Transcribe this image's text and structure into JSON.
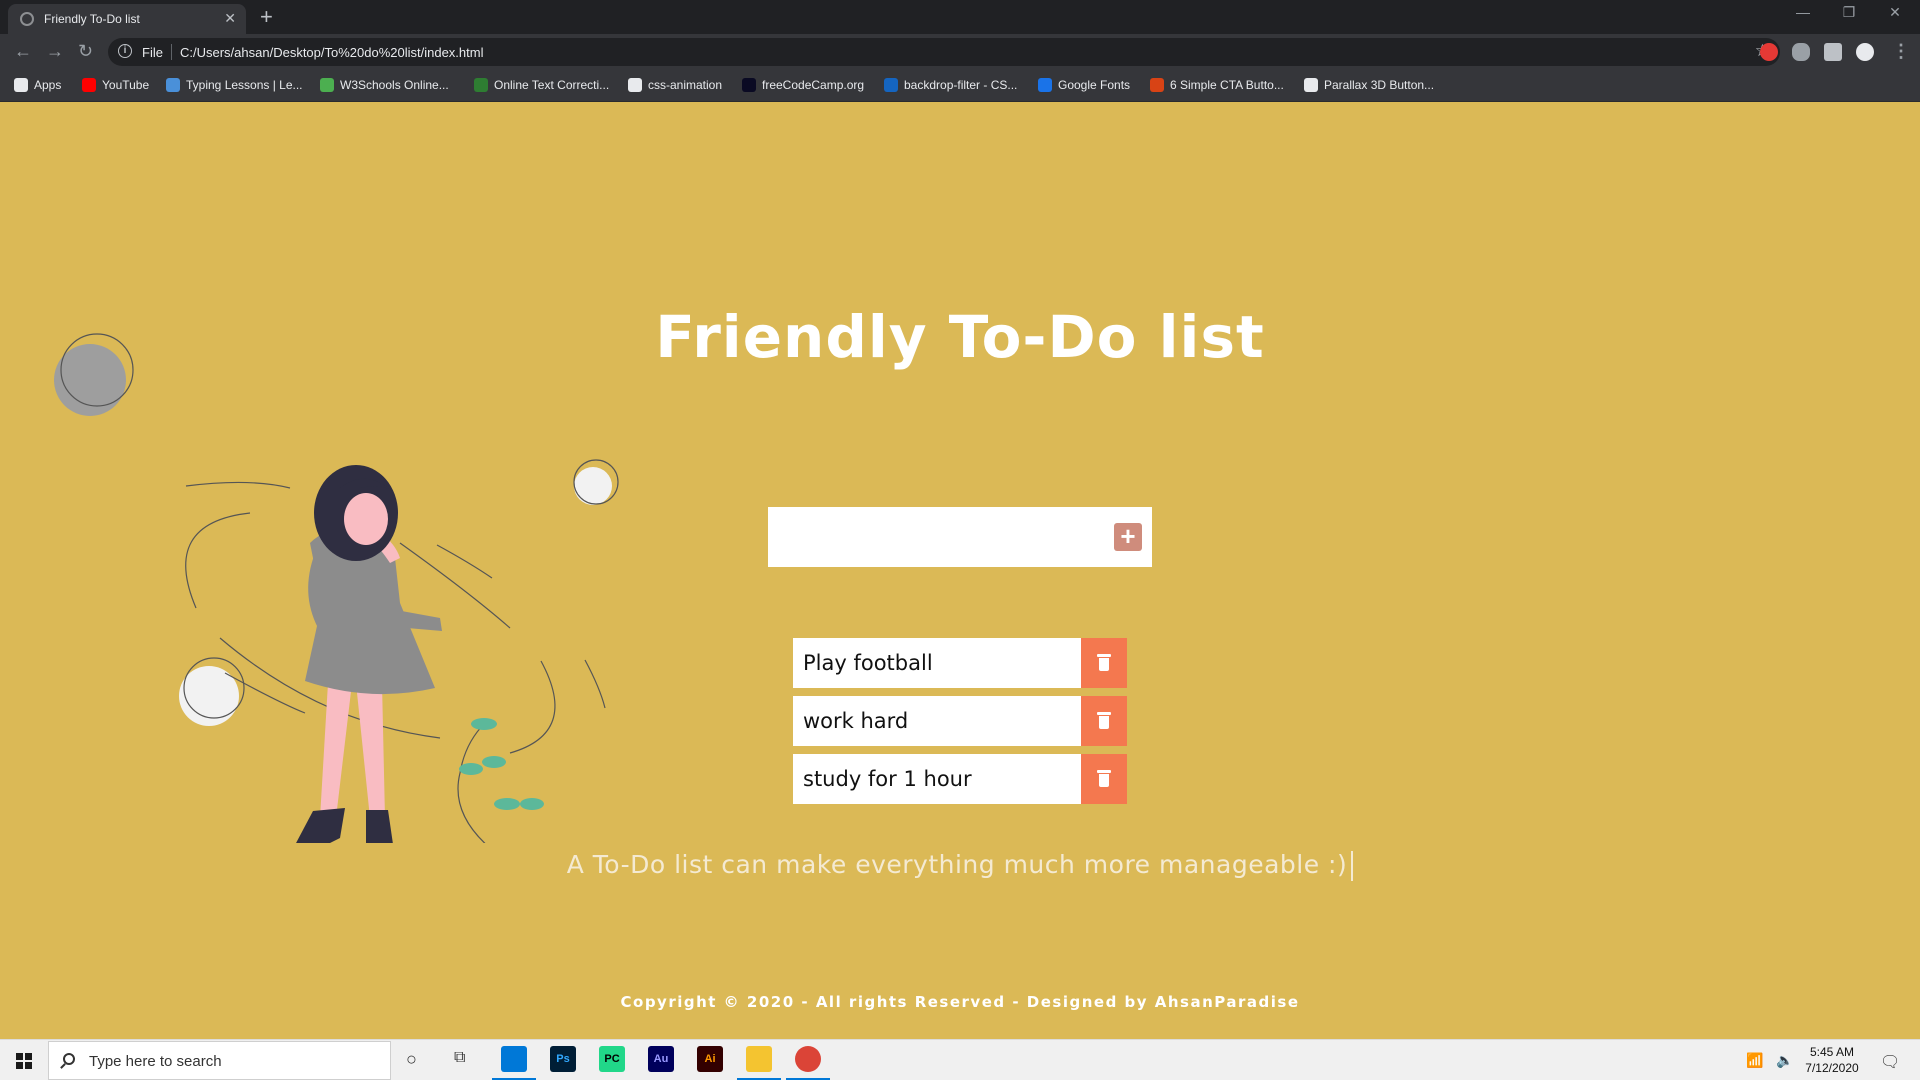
{
  "browser": {
    "tab_title": "Friendly To-Do list",
    "new_tab": "+",
    "address": {
      "scheme_label": "File",
      "url": "C:/Users/ahsan/Desktop/To%20do%20list/index.html"
    },
    "bookmarks": [
      {
        "label": "Apps",
        "color": "#e8eaed"
      },
      {
        "label": "YouTube",
        "color": "#ff0000"
      },
      {
        "label": "Typing Lessons | Le...",
        "color": "#4a90d9"
      },
      {
        "label": "W3Schools Online...",
        "color": "#4caf50"
      },
      {
        "label": "Online Text Correcti...",
        "color": "#2e7d32"
      },
      {
        "label": "css-animation",
        "color": "#e8eaed"
      },
      {
        "label": "freeCodeCamp.org",
        "color": "#0a0a23"
      },
      {
        "label": "backdrop-filter - CS...",
        "color": "#1565c0"
      },
      {
        "label": "Google Fonts",
        "color": "#1a73e8"
      },
      {
        "label": "6 Simple CTA Butto...",
        "color": "#d84315"
      },
      {
        "label": "Parallax 3D Button...",
        "color": "#e8eaed"
      }
    ]
  },
  "app": {
    "title": "Friendly To-Do list",
    "input_placeholder": "",
    "add_label": "+",
    "todos": [
      {
        "text": "Play football"
      },
      {
        "text": "work hard"
      },
      {
        "text": "study for 1 hour"
      }
    ],
    "tagline": "A To-Do list can make everything much more manageable :)",
    "footer": "Copyright © 2020 - All rights Reserved - Designed by AhsanParadise"
  },
  "colors": {
    "background": "#dbb956",
    "delete_button": "#f4784f",
    "add_button": "#cf8c7c"
  },
  "taskbar": {
    "search_placeholder": "Type here to search",
    "apps": [
      {
        "name": "vscode-icon",
        "label": "",
        "color": "#0078d7"
      },
      {
        "name": "photoshop-icon",
        "label": "Ps",
        "color": "#001e36"
      },
      {
        "name": "pycharm-icon",
        "label": "PC",
        "color": "#21d789"
      },
      {
        "name": "audition-icon",
        "label": "Au",
        "color": "#00005b"
      },
      {
        "name": "illustrator-icon",
        "label": "Ai",
        "color": "#330000"
      },
      {
        "name": "file-explorer-icon",
        "label": "",
        "color": "#f4c430"
      },
      {
        "name": "chrome-icon",
        "label": "",
        "color": "#db4437"
      }
    ],
    "time": "5:45 AM",
    "date": "7/12/2020"
  }
}
